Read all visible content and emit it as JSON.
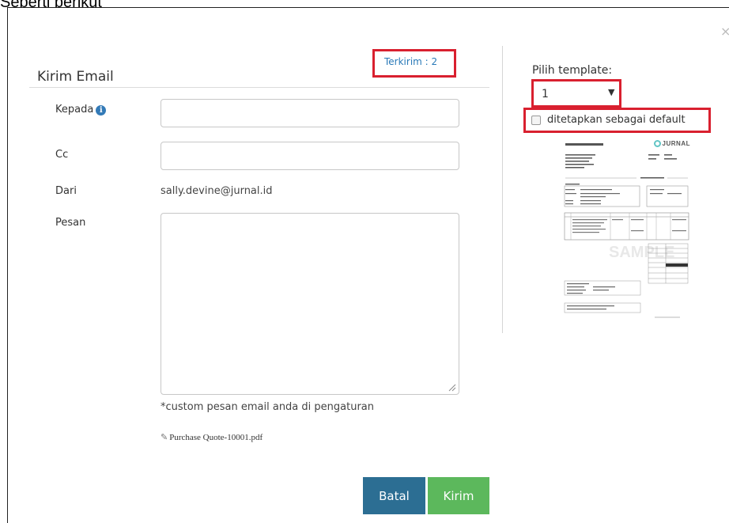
{
  "page_caption": "Seperti berikut",
  "modal": {
    "close_glyph": "×",
    "title": "Kirim Email",
    "sent_count": "Terkirim : 2"
  },
  "form": {
    "to_label": "Kepada",
    "to_info_glyph": "i",
    "cc_label": "Cc",
    "from_label": "Dari",
    "from_value": "sally.devine@jurnal.id",
    "message_label": "Pesan",
    "message_note": "*custom pesan email anda di pengaturan",
    "attachment_icon": "paperclip-icon",
    "attachment_glyph": "✎",
    "attachment_name": "Purchase Quote-10001.pdf"
  },
  "buttons": {
    "cancel": "Batal",
    "send": "Kirim"
  },
  "template": {
    "label": "Pilih template:",
    "selected": "1",
    "arrow_glyph": "▼",
    "default_label": "ditetapkan sebagai default",
    "default_checked": false,
    "preview_logo": "JURNAL"
  },
  "colors": {
    "highlight_border": "#d9202f",
    "link_blue": "#2a7ab8",
    "cancel_button": "#2c6e93",
    "send_button": "#5cb85c"
  }
}
